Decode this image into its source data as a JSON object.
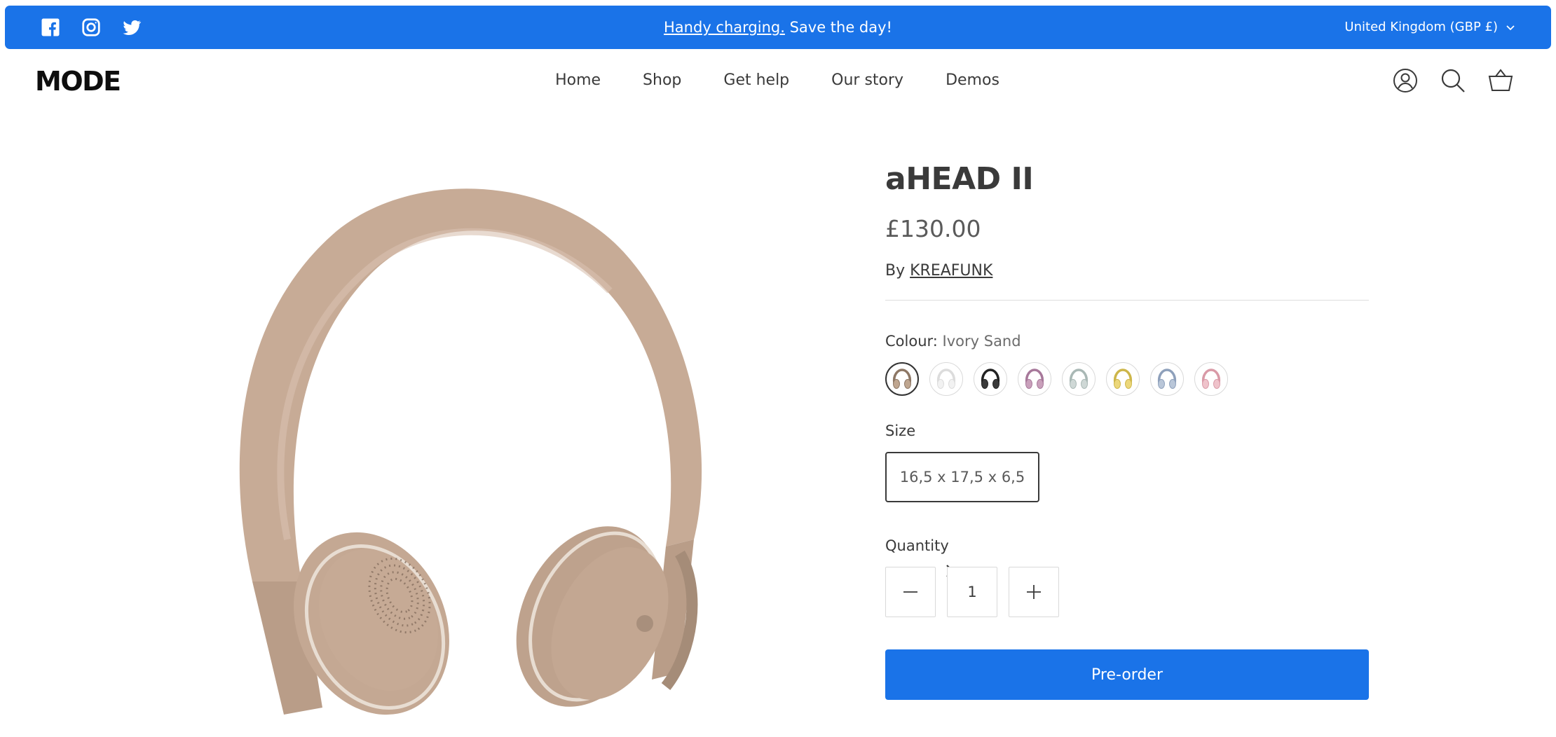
{
  "announcement": {
    "link_text": "Handy charging.",
    "text": " Save the day!",
    "currency_label": "United Kingdom (GBP £)",
    "background_color": "#1a73e8"
  },
  "social": [
    "facebook-icon",
    "instagram-icon",
    "twitter-icon"
  ],
  "header": {
    "logo": "MODE",
    "nav": [
      "Home",
      "Shop",
      "Get help",
      "Our story",
      "Demos"
    ],
    "icons": [
      "account-icon",
      "search-icon",
      "cart-basket-icon"
    ]
  },
  "product": {
    "title": "aHEAD II",
    "price": "£130.00",
    "vendor_prefix": "By ",
    "vendor": "KREAFUNK",
    "colour_label": "Colour:",
    "colour_value": "Ivory Sand",
    "swatches": [
      {
        "color": "#bfa690",
        "band": "#8d7765",
        "active": true
      },
      {
        "color": "#f2f2f2",
        "band": "#dcdcdc",
        "active": false
      },
      {
        "color": "#3a3a3a",
        "band": "#222222",
        "active": false
      },
      {
        "color": "#c9a0bb",
        "band": "#a7789a",
        "active": false
      },
      {
        "color": "#cfd8d6",
        "band": "#a9b8b5",
        "active": false
      },
      {
        "color": "#ecd77a",
        "band": "#cdb64a",
        "active": false
      },
      {
        "color": "#b9c6d8",
        "band": "#8ea0bb",
        "active": false
      },
      {
        "color": "#efc3cb",
        "band": "#d99aa7",
        "active": false
      }
    ],
    "size_label": "Size",
    "size_value": "16,5 x 17,5 x 6,5",
    "quantity_label": "Quantity",
    "quantity": "1",
    "preorder_label": "Pre-order",
    "accent_color": "#1a73e8"
  }
}
